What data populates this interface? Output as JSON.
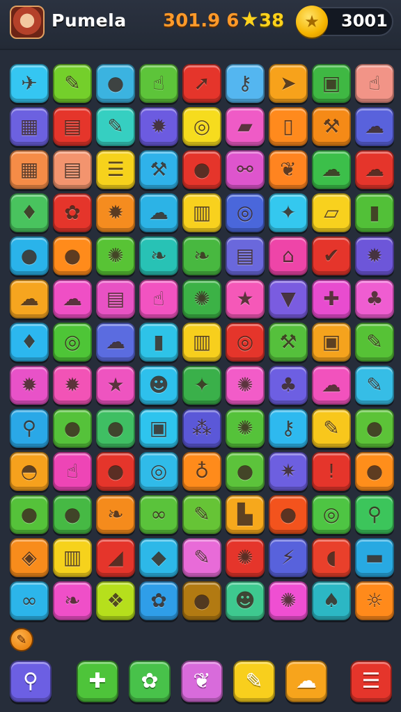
{
  "header": {
    "player_name": "Pumela",
    "score": "301.9 6",
    "stars": "38",
    "coins": "3001"
  },
  "icons": {
    "avatar": "character-avatar",
    "star": "star-icon",
    "coin": "coin-icon"
  },
  "board": {
    "rows": [
      [
        {
          "color": "#35c6f2",
          "icon": "plane"
        },
        {
          "color": "#74cf2b",
          "icon": "pencil"
        },
        {
          "color": "#3bb3e0",
          "icon": "chat-bubble"
        },
        {
          "color": "#5dc43a",
          "icon": "hand"
        },
        {
          "color": "#e5352b",
          "icon": "arrow"
        },
        {
          "color": "#54b6f0",
          "icon": "key"
        },
        {
          "color": "#f7a21b",
          "icon": "paper-plane"
        },
        {
          "color": "#3fb843",
          "icon": "box"
        },
        {
          "color": "#f29487",
          "icon": "hand"
        }
      ],
      [
        {
          "color": "#6c61e0",
          "icon": "robot"
        },
        {
          "color": "#e5352b",
          "icon": "printer"
        },
        {
          "color": "#36cfc1",
          "icon": "pencil"
        },
        {
          "color": "#6c5be0",
          "icon": "gear"
        },
        {
          "color": "#f6dc1e",
          "icon": "ring"
        },
        {
          "color": "#ef5bc6",
          "icon": "folder"
        },
        {
          "color": "#ff8a1d",
          "icon": "phone"
        },
        {
          "color": "#f58a17",
          "icon": "tool"
        },
        {
          "color": "#5962dc",
          "icon": "cloud"
        }
      ],
      [
        {
          "color": "#f58c47",
          "icon": "grid"
        },
        {
          "color": "#f3946e",
          "icon": "note"
        },
        {
          "color": "#f6d21c",
          "icon": "list"
        },
        {
          "color": "#2fb2ea",
          "icon": "wrench"
        },
        {
          "color": "#e5352b",
          "icon": "balloon"
        },
        {
          "color": "#de55cd",
          "icon": "dumbbell"
        },
        {
          "color": "#ff8420",
          "icon": "ribbon"
        },
        {
          "color": "#3cbf4a",
          "icon": "cloud"
        },
        {
          "color": "#e5352b",
          "icon": "cloud"
        }
      ],
      [
        {
          "color": "#49c35e",
          "icon": "gem"
        },
        {
          "color": "#e5352b",
          "icon": "creature"
        },
        {
          "color": "#f58c1f",
          "icon": "gear"
        },
        {
          "color": "#2cb3e6",
          "icon": "cloud"
        },
        {
          "color": "#f8d11e",
          "icon": "radio"
        },
        {
          "color": "#4a67db",
          "icon": "ring"
        },
        {
          "color": "#34c8ef",
          "icon": "bone"
        },
        {
          "color": "#f8d11e",
          "icon": "paper"
        },
        {
          "color": "#52c038",
          "icon": "bottle"
        }
      ],
      [
        {
          "color": "#2ab3ea",
          "icon": "balloon"
        },
        {
          "color": "#ff8b1b",
          "icon": "balloon"
        },
        {
          "color": "#58c335",
          "icon": "splat"
        },
        {
          "color": "#28c2b5",
          "icon": "leaf"
        },
        {
          "color": "#48b840",
          "icon": "leaf"
        },
        {
          "color": "#6a68dc",
          "icon": "note"
        },
        {
          "color": "#ee45a8",
          "icon": "house"
        },
        {
          "color": "#e5352b",
          "icon": "check"
        },
        {
          "color": "#6d56d9",
          "icon": "gear"
        }
      ],
      [
        {
          "color": "#f6a51f",
          "icon": "cloud"
        },
        {
          "color": "#ef4fc5",
          "icon": "cloud"
        },
        {
          "color": "#e852c4",
          "icon": "printer"
        },
        {
          "color": "#f253c1",
          "icon": "hand"
        },
        {
          "color": "#3cb246",
          "icon": "splat"
        },
        {
          "color": "#f558b8",
          "icon": "star"
        },
        {
          "color": "#7a5ce0",
          "icon": "bin"
        },
        {
          "color": "#e84ccf",
          "icon": "cross"
        },
        {
          "color": "#ef5dd1",
          "icon": "tree"
        }
      ],
      [
        {
          "color": "#2cb7ef",
          "icon": "gem"
        },
        {
          "color": "#4ec537",
          "icon": "ring"
        },
        {
          "color": "#5b6ce0",
          "icon": "cloud"
        },
        {
          "color": "#2ec3e8",
          "icon": "battery"
        },
        {
          "color": "#f7cf1d",
          "icon": "radio"
        },
        {
          "color": "#e5352b",
          "icon": "ring"
        },
        {
          "color": "#55c03c",
          "icon": "tool"
        },
        {
          "color": "#f5a31d",
          "icon": "jar"
        },
        {
          "color": "#56c236",
          "icon": "pencil"
        }
      ],
      [
        {
          "color": "#e852c8",
          "icon": "gear"
        },
        {
          "color": "#f253b6",
          "icon": "gear"
        },
        {
          "color": "#ee54c0",
          "icon": "star"
        },
        {
          "color": "#2ec0ec",
          "icon": "face"
        },
        {
          "color": "#3ab04a",
          "icon": "puzzle"
        },
        {
          "color": "#f25cc8",
          "icon": "splat"
        },
        {
          "color": "#6d5fe2",
          "icon": "tree"
        },
        {
          "color": "#f252bd",
          "icon": "cloud"
        },
        {
          "color": "#36bde6",
          "icon": "pencil"
        }
      ],
      [
        {
          "color": "#2aa8e7",
          "icon": "magnifier"
        },
        {
          "color": "#55c23a",
          "icon": "apple"
        },
        {
          "color": "#3fbf63",
          "icon": "balloon"
        },
        {
          "color": "#2ec4ee",
          "icon": "jar"
        },
        {
          "color": "#5b58d8",
          "icon": "berries"
        },
        {
          "color": "#55c23a",
          "icon": "splat"
        },
        {
          "color": "#2eb9ef",
          "icon": "key"
        },
        {
          "color": "#f8c71c",
          "icon": "pencil"
        },
        {
          "color": "#5cc338",
          "icon": "mango"
        }
      ],
      [
        {
          "color": "#f6a11d",
          "icon": "fan"
        },
        {
          "color": "#ee45b6",
          "icon": "hand"
        },
        {
          "color": "#e5352b",
          "icon": "balloon"
        },
        {
          "color": "#30bbe9",
          "icon": "ring"
        },
        {
          "color": "#ff8b1b",
          "icon": "bulb"
        },
        {
          "color": "#5cc33b",
          "icon": "chat-bubble"
        },
        {
          "color": "#6d5fe0",
          "icon": "burst"
        },
        {
          "color": "#e5352b",
          "icon": "exclamation"
        },
        {
          "color": "#ff8e1b",
          "icon": "apple"
        }
      ],
      [
        {
          "color": "#55c23a",
          "icon": "fruit"
        },
        {
          "color": "#46b944",
          "icon": "plum"
        },
        {
          "color": "#f58b1c",
          "icon": "leaf"
        },
        {
          "color": "#5ac33b",
          "icon": "pretzel"
        },
        {
          "color": "#66c436",
          "icon": "pencil"
        },
        {
          "color": "#f6a81c",
          "icon": "boot"
        },
        {
          "color": "#f3531d",
          "icon": "chat-bubble"
        },
        {
          "color": "#4ec543",
          "icon": "ring"
        },
        {
          "color": "#3cc55b",
          "icon": "magnifier"
        }
      ],
      [
        {
          "color": "#f88c1c",
          "icon": "shield"
        },
        {
          "color": "#f6d21c",
          "icon": "building"
        },
        {
          "color": "#e5352b",
          "icon": "knife"
        },
        {
          "color": "#2db8e8",
          "icon": "kite"
        },
        {
          "color": "#e86bd8",
          "icon": "pencil"
        },
        {
          "color": "#e5352b",
          "icon": "splat"
        },
        {
          "color": "#5862dc",
          "icon": "bolt"
        },
        {
          "color": "#e9402b",
          "icon": "bread"
        },
        {
          "color": "#28a9e2",
          "icon": "chest"
        }
      ],
      [
        {
          "color": "#2cb5ea",
          "icon": "glasses"
        },
        {
          "color": "#ef4fc8",
          "icon": "leaf"
        },
        {
          "color": "#b6df1c",
          "icon": "candy"
        },
        {
          "color": "#2f9ee8",
          "icon": "creature"
        },
        {
          "color": "#b27a12",
          "icon": "balloon"
        },
        {
          "color": "#3ec98f",
          "icon": "face"
        },
        {
          "color": "#ef4fd2",
          "icon": "splat"
        },
        {
          "color": "#2cb7c4",
          "icon": "plant"
        },
        {
          "color": "#ff8a1b",
          "icon": "ghost"
        }
      ]
    ]
  },
  "hint_button": {
    "icon": "hint-icon"
  },
  "toolbar": {
    "tools": [
      {
        "name": "magnifier-tool",
        "icon": "magnifier-icon",
        "color": "#6c5fe3"
      },
      {
        "name": "add-tool",
        "icon": "plus-icon",
        "color": "#4ec43a"
      },
      {
        "name": "flower-tool",
        "icon": "flower-icon",
        "color": "#48c24a"
      },
      {
        "name": "cherry-tool",
        "icon": "cherry-icon",
        "color": "#d86bdb"
      },
      {
        "name": "pencil-tool",
        "icon": "pencil-icon",
        "color": "#f8cf1d"
      },
      {
        "name": "cloud-tool",
        "icon": "cloud-icon",
        "color": "#f7a41c"
      },
      {
        "name": "menu-tool",
        "icon": "menu-icon",
        "color": "#e5352b"
      }
    ]
  }
}
